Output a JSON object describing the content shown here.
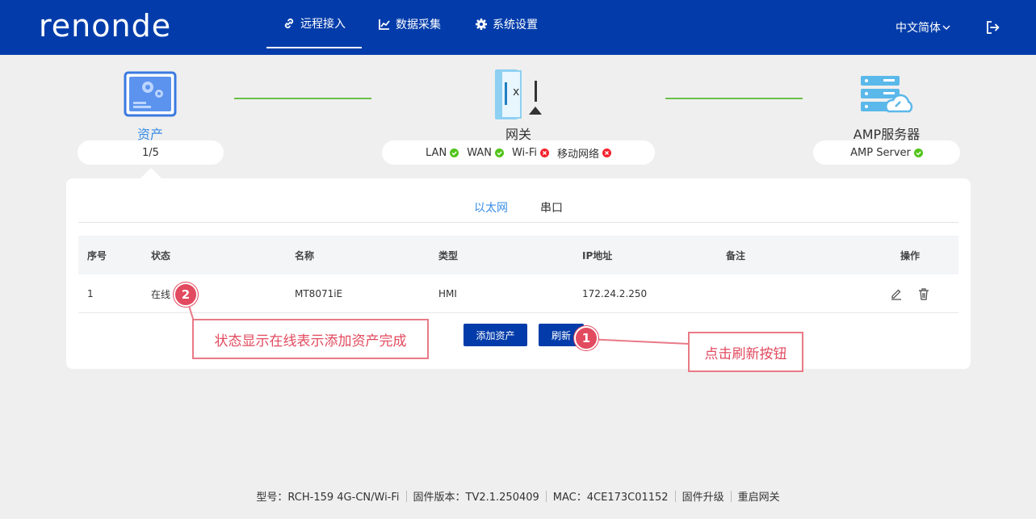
{
  "header": {
    "logo": "renonde",
    "nav": [
      {
        "label": "远程接入",
        "icon": "link-icon"
      },
      {
        "label": "数据采集",
        "icon": "chart-icon"
      },
      {
        "label": "系统设置",
        "icon": "gear-icon"
      }
    ],
    "language": "中文简体"
  },
  "topology": {
    "asset": {
      "label": "资产",
      "count": "1/5"
    },
    "gateway": {
      "label": "网关",
      "interfaces": [
        {
          "name": "LAN",
          "status": "ok"
        },
        {
          "name": "WAN",
          "status": "ok"
        },
        {
          "name": "Wi-Fi",
          "status": "error"
        },
        {
          "name": "移动网络",
          "status": "error"
        }
      ]
    },
    "server": {
      "label": "AMP服务器",
      "status_label": "AMP Server",
      "status": "ok"
    }
  },
  "tabs": [
    "以太网",
    "串口"
  ],
  "table": {
    "columns": [
      "序号",
      "状态",
      "名称",
      "类型",
      "IP地址",
      "备注",
      "操作"
    ],
    "rows": [
      {
        "index": "1",
        "status": "在线",
        "name": "MT8071iE",
        "type": "HMI",
        "ip": "172.24.2.250",
        "note": ""
      }
    ]
  },
  "buttons": {
    "add": "添加资产",
    "refresh": "刷新"
  },
  "annotations": {
    "badge1": "1",
    "badge2": "2",
    "callout1": "点击刷新按钮",
    "callout2": "状态显示在线表示添加资产完成"
  },
  "footer": {
    "model": "型号：RCH-159  4G-CN/Wi-Fi",
    "firmware": "固件版本：TV2.1.250409",
    "mac": "MAC：4CE173C01152",
    "upgrade": "固件升级",
    "restart": "重启网关"
  },
  "colors": {
    "brand": "#033caa",
    "accent": "#3a8ee6",
    "ok": "#52c41a",
    "error": "#f5222d",
    "annotation": "#e24a5f"
  }
}
